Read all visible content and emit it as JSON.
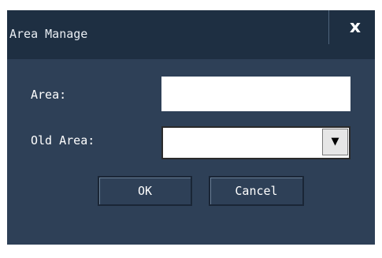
{
  "window": {
    "title": "Area Manage",
    "close_glyph": "x",
    "close_icon": "close-icon"
  },
  "form": {
    "area_label": "Area:",
    "area_value": "",
    "old_area_label": "Old Area:",
    "old_area_selected": "",
    "dropdown_icon": "chevron-down-icon",
    "dropdown_glyph": "▼"
  },
  "buttons": {
    "ok_label": "OK",
    "cancel_label": "Cancel"
  },
  "colors": {
    "dialog_background": "#2e4057",
    "titlebar_background": "#1e2f42",
    "text": "#ffffff"
  }
}
